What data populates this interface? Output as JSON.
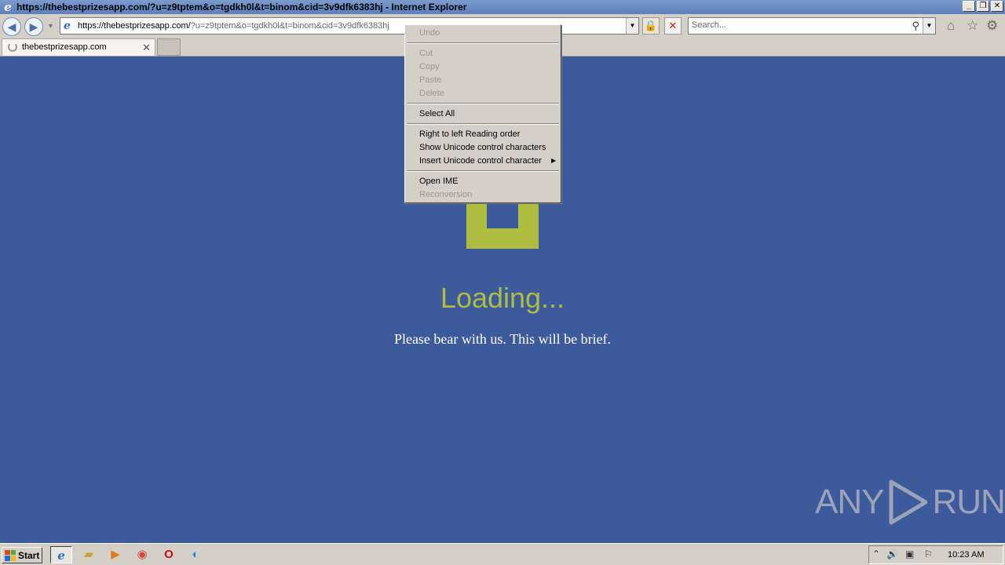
{
  "window": {
    "title": "https://thebestprizesapp.com/?u=z9tptem&o=tgdkh0l&t=binom&cid=3v9dfk6383hj - Internet Explorer",
    "controls": [
      "_",
      "❐",
      "✕"
    ]
  },
  "navbar": {
    "address_host": "https://thebestprizesapp.com/",
    "address_rest": "?u=z9tptem&o=tgdkh0l&t=binom&cid=3v9dfk6383hj",
    "search_placeholder": "Search..."
  },
  "tabs": [
    {
      "label": "thebestprizesapp.com",
      "loading": true
    }
  ],
  "page": {
    "loading_text": "Loading...",
    "subtitle": "Please bear with us. This will be brief.",
    "accent_color": "#adbd3f",
    "background_color": "#3d5a9c"
  },
  "context_menu": {
    "items": [
      {
        "label": "Undo",
        "enabled": false
      },
      {
        "label": "Cut",
        "enabled": false
      },
      {
        "label": "Copy",
        "enabled": false
      },
      {
        "label": "Paste",
        "enabled": false
      },
      {
        "label": "Delete",
        "enabled": false
      },
      {
        "label": "Select All",
        "enabled": true
      },
      {
        "label": "Right to left Reading order",
        "enabled": true
      },
      {
        "label": "Show Unicode control characters",
        "enabled": true
      },
      {
        "label": "Insert Unicode control character",
        "enabled": true,
        "submenu": true
      },
      {
        "label": "Open IME",
        "enabled": true
      },
      {
        "label": "Reconversion",
        "enabled": false
      }
    ]
  },
  "watermark": {
    "left": "ANY",
    "right": "RUN"
  },
  "taskbar": {
    "start_label": "Start",
    "apps": [
      "internet-explorer-icon",
      "folder-icon",
      "media-player-icon",
      "chrome-icon",
      "opera-icon",
      "edge-icon"
    ],
    "clock": "10:23 AM"
  }
}
